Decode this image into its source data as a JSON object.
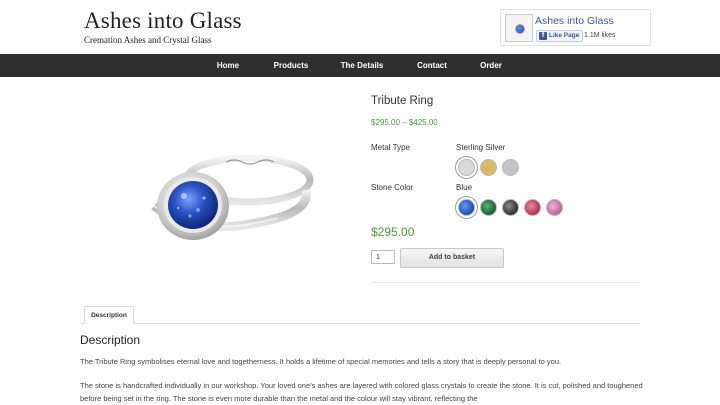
{
  "site": {
    "title": "Ashes into Glass",
    "subtitle": "Cremation Ashes and Crystal Glass"
  },
  "facebook": {
    "page_name": "Ashes into Glass",
    "like_label": "Like Page",
    "likes": "1.1M likes"
  },
  "nav": {
    "items": [
      {
        "label": "Home"
      },
      {
        "label": "Products"
      },
      {
        "label": "The Details"
      },
      {
        "label": "Contact"
      },
      {
        "label": "Order"
      }
    ]
  },
  "product": {
    "title": "Tribute Ring",
    "price_range": "$295.00 – $425.00",
    "metal_label": "Metal Type",
    "metal_value": "Sterling Silver",
    "metal_swatches": [
      {
        "name": "sterling-silver",
        "color": "#d8d8d8",
        "selected": true
      },
      {
        "name": "gold",
        "color": "#d9b86a",
        "selected": false
      },
      {
        "name": "white-gold",
        "color": "#c2c4c6",
        "selected": false
      }
    ],
    "stone_label": "Stone Color",
    "stone_value": "Blue",
    "stone_swatches": [
      {
        "name": "blue",
        "color": "#2456b8",
        "selected": true
      },
      {
        "name": "green",
        "color": "#1e6b3a",
        "selected": false
      },
      {
        "name": "black",
        "color": "#3a3a3e",
        "selected": false
      },
      {
        "name": "red",
        "color": "#b83c55",
        "selected": false
      },
      {
        "name": "pink",
        "color": "#c06fa8",
        "selected": false
      }
    ],
    "price": "$295.00",
    "quantity": "1",
    "add_to_basket": "Add to basket"
  },
  "tabs": [
    {
      "label": "Description"
    }
  ],
  "description": {
    "heading": "Description",
    "paragraphs": [
      "The Tribute Ring symbolises eternal love and togetherness. It holds a lifetime of special memories and tells a story that is deeply personal to you.",
      "The stone is handcrafted individually in our workshop. Your loved one’s ashes are layered with colored glass crystals to create the stone. It is cut, polished and toughened before being set in the ring. The stone is even more durable than the metal and the colour will stay vibrant, reflecting the"
    ]
  },
  "colors": {
    "accent_green": "#4a9a3a",
    "nav_background": "#2f2f2f",
    "facebook_blue": "#3b5998"
  }
}
